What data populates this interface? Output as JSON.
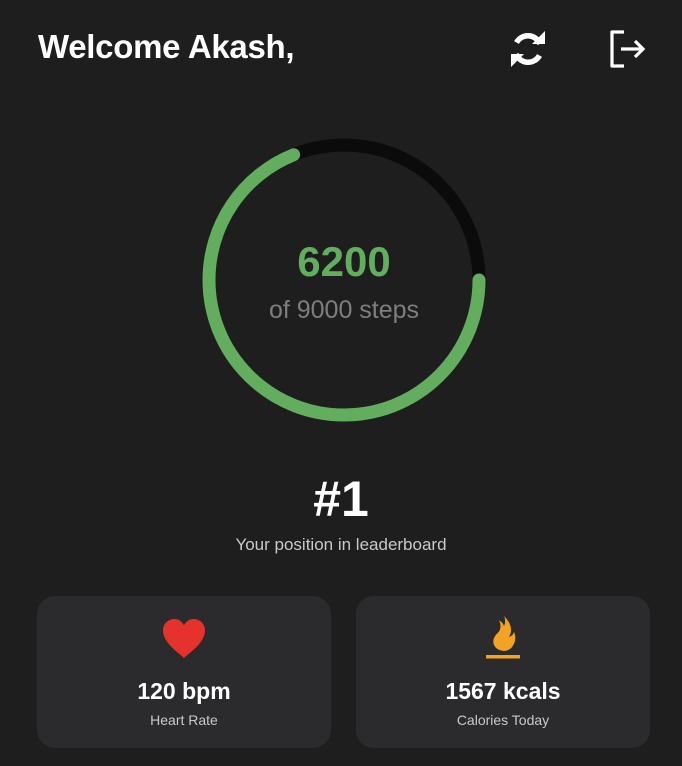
{
  "header": {
    "welcome_text": "Welcome Akash,",
    "refresh_icon": "refresh-icon",
    "logout_icon": "logout-icon"
  },
  "steps": {
    "current": "6200",
    "goal_text": "of 9000 steps",
    "current_value": 6200,
    "goal_value": 9000,
    "progress_color": "#62ae5e",
    "track_color": "#0b0b0b"
  },
  "leaderboard": {
    "rank": "#1",
    "label": "Your position in leaderboard"
  },
  "cards": {
    "heart": {
      "icon": "heart-icon",
      "value": "120 bpm",
      "label": "Heart Rate",
      "color": "#e5322d"
    },
    "calories": {
      "icon": "flame-icon",
      "value": "1567 kcals",
      "label": "Calories Today",
      "color": "#f2a324"
    }
  },
  "colors": {
    "background": "#1e1e1f",
    "card": "#2b2b2d"
  }
}
